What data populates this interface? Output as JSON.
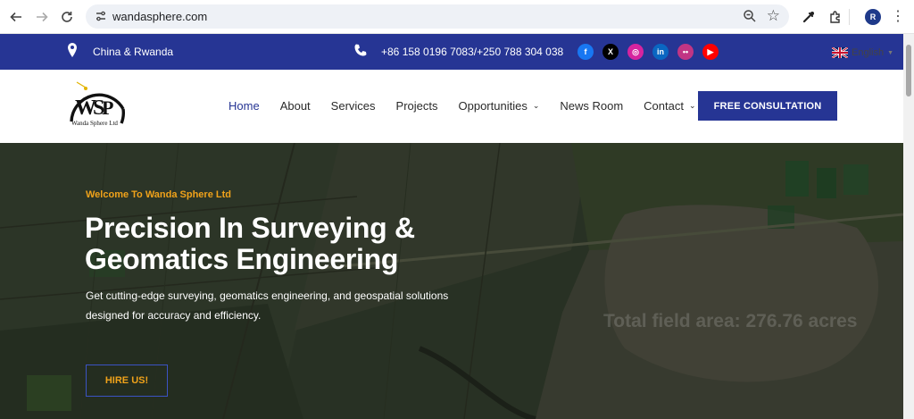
{
  "browser": {
    "url": "wandasphere.com",
    "profile_initial": "R"
  },
  "topbar": {
    "location": "China &  Rwanda",
    "phones": "+86 158 0196 7083/+250 788 304 038",
    "social": [
      {
        "name": "facebook-icon",
        "glyph": "f",
        "color": "#1877f2"
      },
      {
        "name": "x-icon",
        "glyph": "X",
        "color": "#000000"
      },
      {
        "name": "instagram-icon",
        "glyph": "◎",
        "color": "#d6249f"
      },
      {
        "name": "linkedin-icon",
        "glyph": "in",
        "color": "#0a66c2"
      },
      {
        "name": "flickr-icon",
        "glyph": "••",
        "color": "#c13584"
      },
      {
        "name": "youtube-icon",
        "glyph": "▶",
        "color": "#ff0000"
      }
    ],
    "language": "English"
  },
  "header": {
    "logo_caption": "Wanda Sphere Ltd",
    "menu": [
      {
        "label": "Home",
        "active": true,
        "dropdown": false
      },
      {
        "label": "About",
        "active": false,
        "dropdown": false
      },
      {
        "label": "Services",
        "active": false,
        "dropdown": false
      },
      {
        "label": "Projects",
        "active": false,
        "dropdown": false
      },
      {
        "label": "Opportunities",
        "active": false,
        "dropdown": true
      },
      {
        "label": "News Room",
        "active": false,
        "dropdown": false
      },
      {
        "label": "Contact",
        "active": false,
        "dropdown": true
      }
    ],
    "cta_label": "FREE CONSULTATION"
  },
  "hero": {
    "welcome": "Welcome To Wanda Sphere Ltd",
    "title": "Precision In Surveying & Geomatics Engineering",
    "subtitle": "Get cutting-edge surveying, geomatics engineering, and geospatial solutions designed for accuracy and efficiency.",
    "watermark": "Total field area: 276.76 acres",
    "button_label": "HIRE US!"
  },
  "colors": {
    "brand_blue": "#263594",
    "accent_orange": "#f0a21a"
  }
}
